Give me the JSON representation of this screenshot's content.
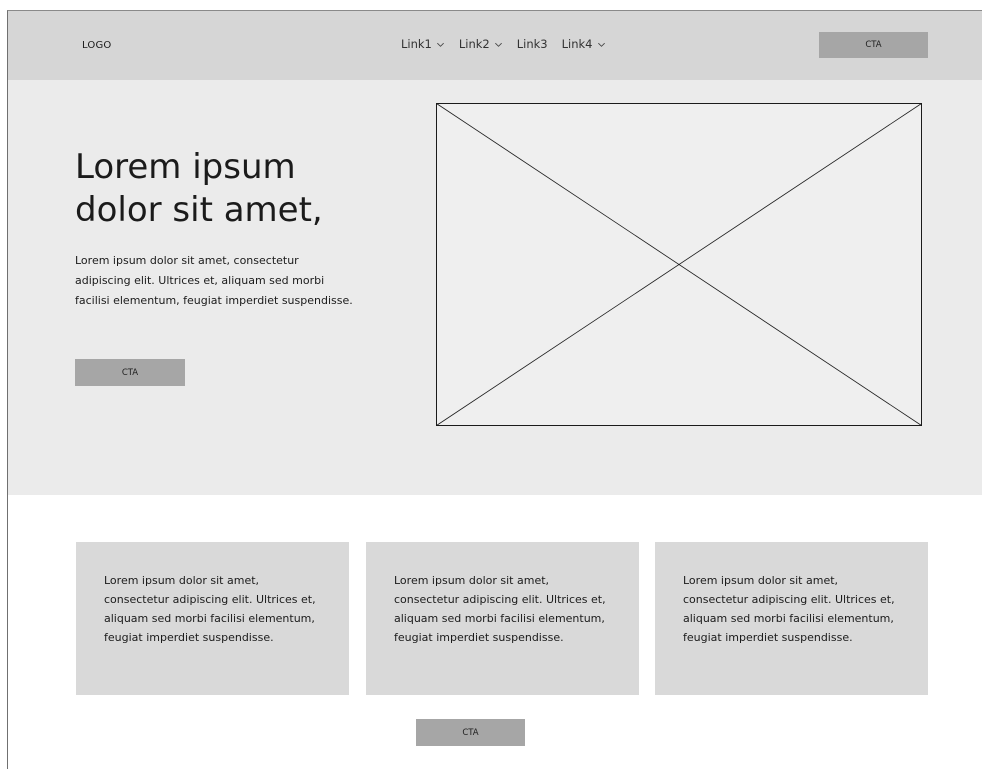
{
  "header": {
    "logo": "LOGO",
    "nav": [
      {
        "label": "Link1",
        "has_dropdown": true
      },
      {
        "label": "Link2",
        "has_dropdown": true
      },
      {
        "label": "Link3",
        "has_dropdown": false
      },
      {
        "label": "Link4",
        "has_dropdown": true
      }
    ],
    "cta_label": "CTA"
  },
  "hero": {
    "title_line1": "Lorem ipsum",
    "title_line2": "dolor sit amet,",
    "body": "Lorem ipsum dolor sit amet, consectetur adipiscing elit. Ultrices et, aliquam sed morbi facilisi elementum, feugiat imperdiet suspendisse.",
    "cta_label": "CTA"
  },
  "cards": [
    {
      "text": "Lorem ipsum dolor sit amet, consectetur adipiscing elit. Ultrices et, aliquam sed morbi facilisi elementum, feugiat imperdiet suspendisse."
    },
    {
      "text": "Lorem ipsum dolor sit amet, consectetur adipiscing elit. Ultrices et, aliquam sed morbi facilisi elementum, feugiat imperdiet suspendisse."
    },
    {
      "text": "Lorem ipsum dolor sit amet, consectetur adipiscing elit. Ultrices et, aliquam sed morbi facilisi elementum, feugiat imperdiet suspendisse."
    }
  ],
  "bottom_cta_label": "CTA",
  "icons": {
    "dropdown": "chevron-down-icon",
    "image_placeholder": "image-placeholder-icon"
  },
  "colors": {
    "header_bg": "#d6d6d6",
    "hero_bg": "#ebebeb",
    "card_bg": "#d9d9d9",
    "cta_bg": "#a6a6a6"
  }
}
